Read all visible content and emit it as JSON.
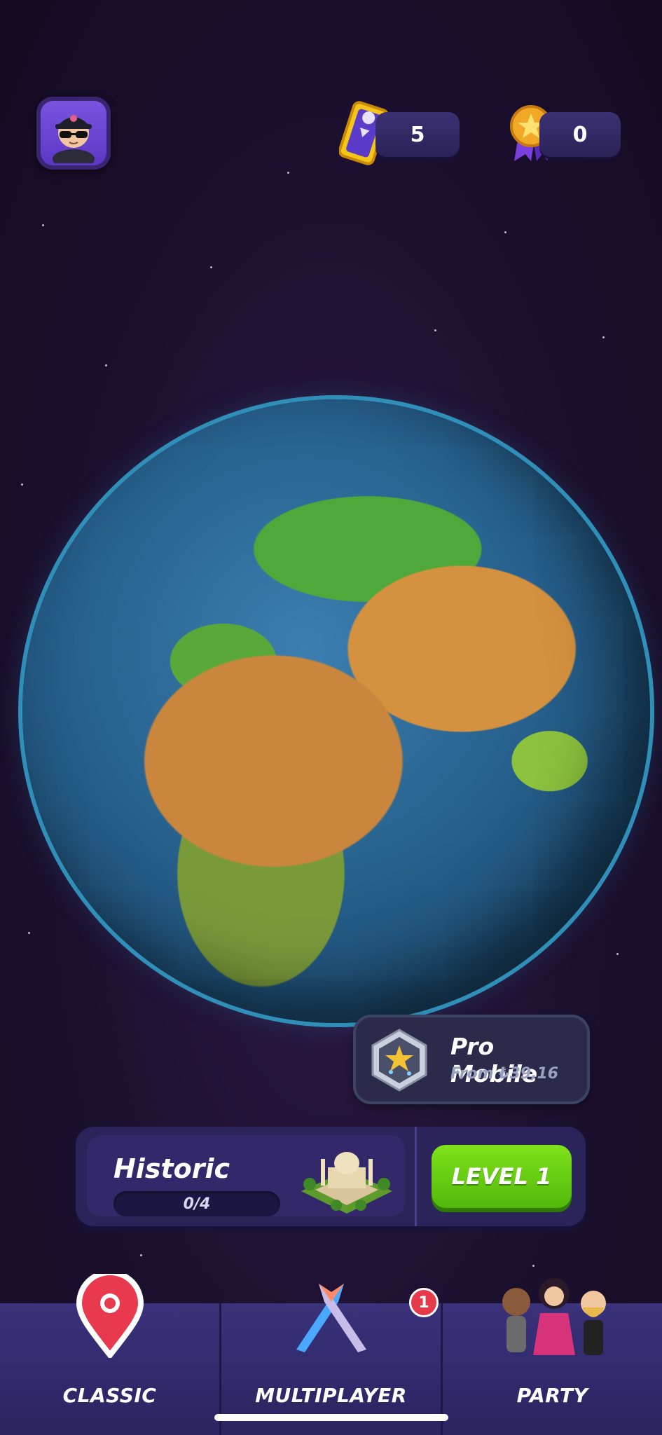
{
  "header": {
    "tickets_count": "5",
    "medals_count": "0"
  },
  "promo": {
    "title": "Pro Mobile",
    "subtitle": "From ₺39,16"
  },
  "mode_card": {
    "title": "Historic",
    "progress": "0/4",
    "level_button": "LEVEL 1"
  },
  "nav": {
    "items": [
      {
        "label": "CLASSIC",
        "icon": "map-pin-icon"
      },
      {
        "label": "MULTIPLAYER",
        "icon": "crossed-swords-icon"
      },
      {
        "label": "PARTY",
        "icon": "characters-icon"
      }
    ],
    "multiplayer_badge": "1"
  },
  "colors": {
    "background": "#1c1030",
    "accent_green": "#6ccc14",
    "card": "#2a245a",
    "badge_red": "#e63a4a"
  }
}
